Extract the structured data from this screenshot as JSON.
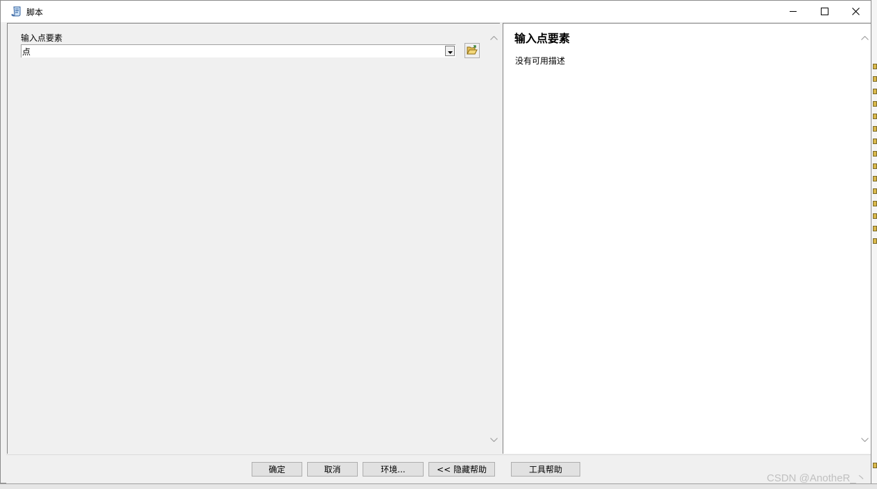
{
  "window": {
    "title": "脚本",
    "icon": "script-icon",
    "controls": [
      "minimize-icon",
      "maximize-icon",
      "close-icon"
    ]
  },
  "form": {
    "field_label": "输入点要素",
    "field_value": "点",
    "browse_icon": "open-folder-icon"
  },
  "help": {
    "title": "输入点要素",
    "description": "没有可用描述"
  },
  "buttons": {
    "ok": "确定",
    "cancel": "取消",
    "environments": "环境...",
    "hide_help": "<< 隐藏帮助",
    "tool_help": "工具帮助"
  },
  "watermark": "CSDN @AnotheR_丶",
  "colors": {
    "window_bg": "#f0f0f0",
    "help_bg": "#ffffff",
    "border": "#808080"
  }
}
